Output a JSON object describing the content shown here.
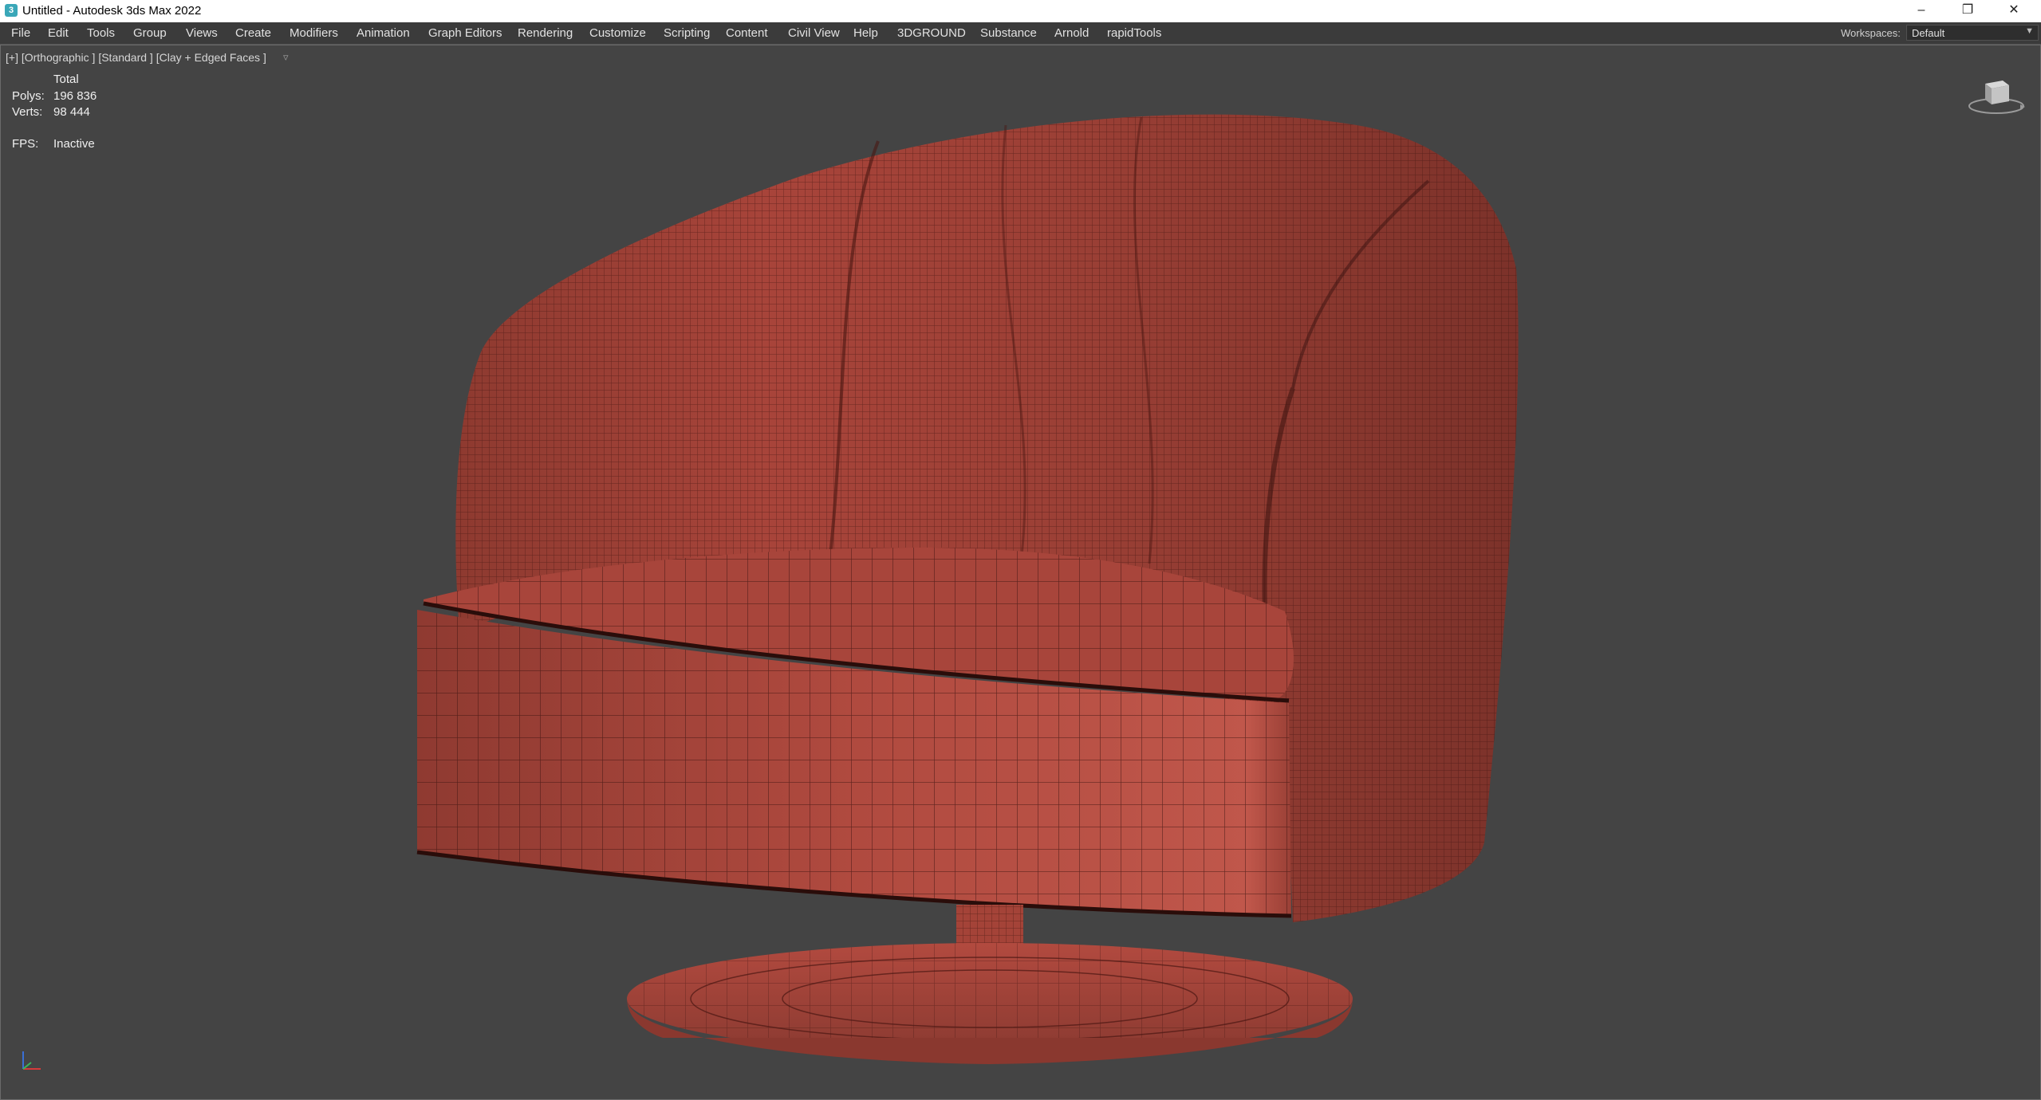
{
  "window": {
    "title": "Untitled - Autodesk 3ds Max 2022",
    "icon": "3ds-max-app-icon",
    "controls": [
      "minimize",
      "restore",
      "close"
    ]
  },
  "menu": {
    "items": [
      "File",
      "Edit",
      "Tools",
      "Group",
      "Views",
      "Create",
      "Modifiers",
      "Animation",
      "Graph Editors",
      "Rendering",
      "Customize",
      "Scripting",
      "Content",
      "Civil View",
      "Help",
      "3DGROUND",
      "Substance",
      "Arnold",
      "rapidTools"
    ],
    "workspaces_label": "Workspaces:",
    "workspaces_value": "Default"
  },
  "viewport": {
    "label": "[+] [Orthographic ] [Standard ] [Clay + Edged Faces ]",
    "stats": {
      "header": "Total",
      "polys_label": "Polys:",
      "polys_value": "196 836",
      "verts_label": "Verts:",
      "verts_value": "98 444",
      "fps_label": "FPS:",
      "fps_value": "Inactive"
    },
    "model_color": "#a8443a",
    "background_color": "#444444"
  }
}
